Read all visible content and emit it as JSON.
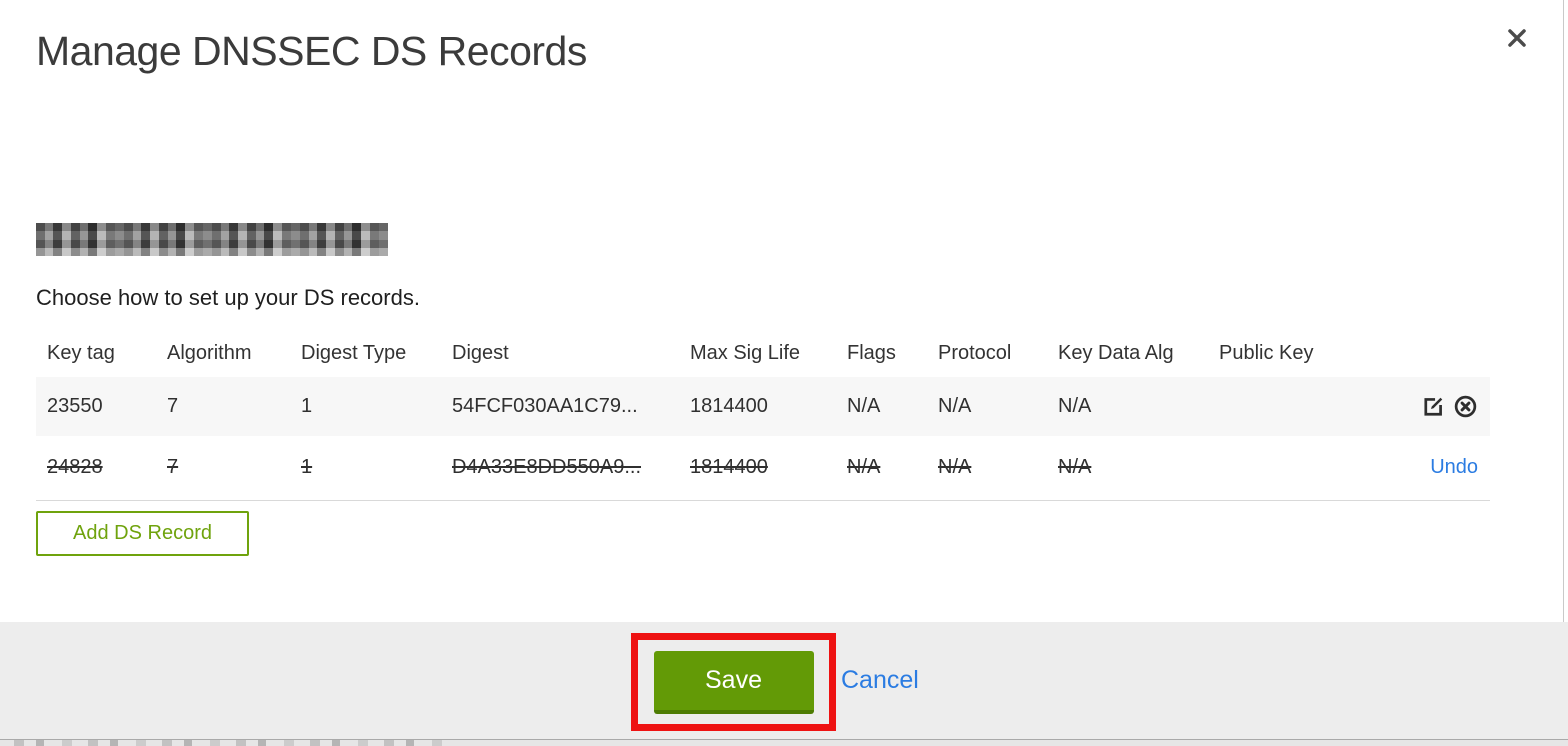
{
  "header": {
    "title": "Manage DNSSEC DS Records"
  },
  "domain_redacted": true,
  "instruction": "Choose how to set up your DS records.",
  "table": {
    "columns": [
      "Key tag",
      "Algorithm",
      "Digest Type",
      "Digest",
      "Max Sig Life",
      "Flags",
      "Protocol",
      "Key Data Alg",
      "Public Key"
    ],
    "rows": [
      {
        "key_tag": "23550",
        "algorithm": "7",
        "digest_type": "1",
        "digest": "54FCF030AA1C79...",
        "max_sig_life": "1814400",
        "flags": "N/A",
        "protocol": "N/A",
        "key_data_alg": "N/A",
        "public_key": "",
        "state": "active"
      },
      {
        "key_tag": "24828",
        "algorithm": "7",
        "digest_type": "1",
        "digest": "D4A33E8DD550A9...",
        "max_sig_life": "1814400",
        "flags": "N/A",
        "protocol": "N/A",
        "key_data_alg": "N/A",
        "public_key": "",
        "state": "marked-for-deletion",
        "undo_label": "Undo"
      }
    ]
  },
  "actions": {
    "add": "Add DS Record",
    "save": "Save",
    "cancel": "Cancel"
  },
  "icons": {
    "close": "close-x",
    "edit": "pencil-square",
    "delete": "circle-x"
  },
  "colors": {
    "save_green": "#639a06",
    "outline_green": "#6fa30d",
    "link_blue": "#2b7ce2",
    "annotation_red": "#ee1212",
    "footer_bg": "#ededed",
    "active_row_bg": "#f7f7f7"
  }
}
